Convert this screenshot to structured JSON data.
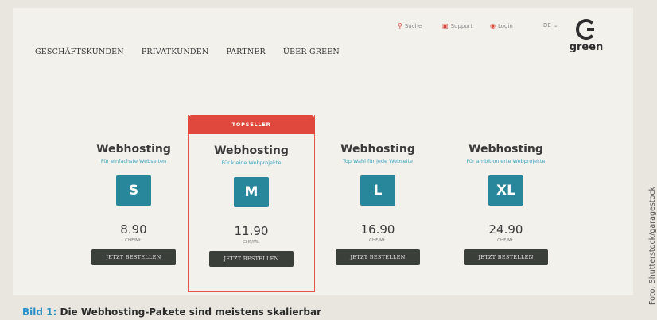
{
  "utility": {
    "search": "Suche",
    "support": "Support",
    "login": "Login",
    "language": "DE"
  },
  "logo": {
    "text": "green"
  },
  "nav": [
    "GESCHÄFTSKUNDEN",
    "PRIVATKUNDEN",
    "PARTNER",
    "ÜBER GREEN"
  ],
  "plans": [
    {
      "name": "Webhosting",
      "subtitle": "Für einfachste Webseiten",
      "size": "S",
      "price": "8.90",
      "currency": "CHF/Mt.",
      "button": "JETZT BESTELLEN"
    },
    {
      "badge": "TOPSELLER",
      "name": "Webhosting",
      "subtitle": "Für kleine Webprojekte",
      "size": "M",
      "price": "11.90",
      "currency": "CHF/Mt.",
      "button": "JETZT BESTELLEN"
    },
    {
      "name": "Webhosting",
      "subtitle": "Top Wahl für jede Webseite",
      "size": "L",
      "price": "16.90",
      "currency": "CHF/Mt.",
      "button": "JETZT BESTELLEN"
    },
    {
      "name": "Webhosting",
      "subtitle": "Für ambitionierte Webprojekte",
      "size": "XL",
      "price": "24.90",
      "currency": "CHF/Mt.",
      "button": "JETZT BESTELLEN"
    }
  ],
  "caption": {
    "figure": "Bild 1:",
    "text": "Die Webhosting-Pakete sind meistens skalierbar"
  },
  "credit": "Foto: Shutterstock/garagestock",
  "colors": {
    "accent_red": "#e0473d",
    "teal": "#28879a",
    "button_dark": "#3a3f3a"
  }
}
